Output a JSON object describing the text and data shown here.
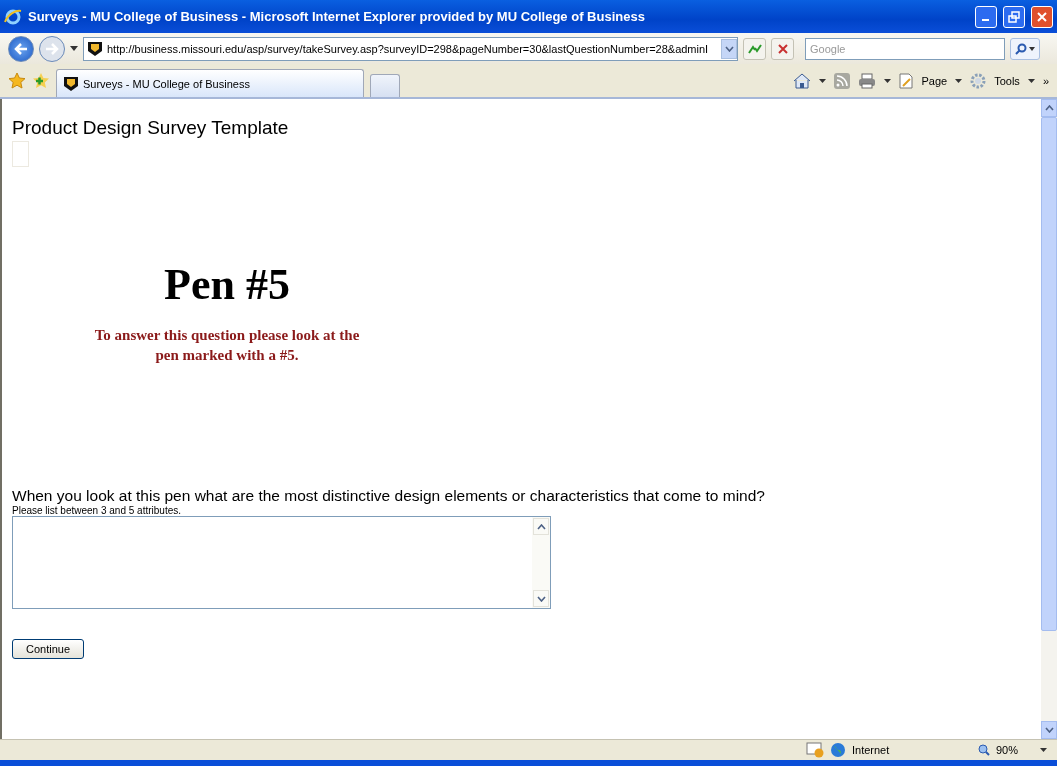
{
  "window": {
    "title": "Surveys - MU College of Business - Microsoft Internet Explorer provided by MU College of Business"
  },
  "address_bar": {
    "url": "http://business.missouri.edu/asp/survey/takeSurvey.asp?surveyID=298&pageNumber=30&lastQuestionNumber=28&adminI"
  },
  "search": {
    "placeholder": "Google"
  },
  "tabs": [
    {
      "label": "Surveys - MU College of Business",
      "selected": true
    }
  ],
  "toolbar": {
    "page": "Page",
    "tools": "Tools",
    "overflow": "»"
  },
  "page": {
    "title": "Product Design Survey Template",
    "heading": "Pen #5",
    "instruction": "To answer this question please look at the pen marked with a #5.",
    "question": "When you look at this pen what are the most distinctive design elements or characteristics that come to mind?",
    "hint": "Please list between 3 and 5 attributes.",
    "button": "Continue"
  },
  "status_bar": {
    "zone": "Internet",
    "zoom": "90%"
  }
}
